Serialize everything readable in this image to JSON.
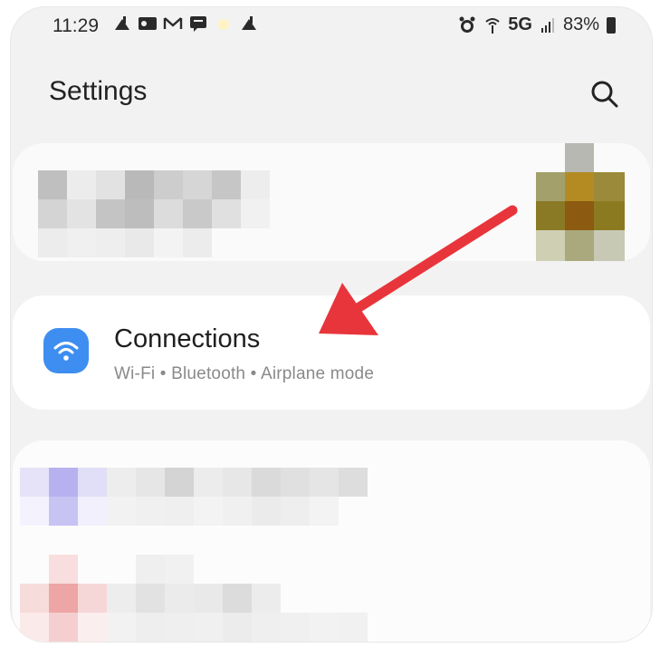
{
  "status_bar": {
    "time": "11:29",
    "network": "5G",
    "battery": "83%"
  },
  "header": {
    "title": "Settings",
    "search_icon": "search-icon"
  },
  "connections": {
    "title": "Connections",
    "subtitle": "Wi-Fi • Bluetooth • Airplane mode",
    "icon": "wifi-icon",
    "icon_color": "#3d8ef0"
  },
  "annotation": {
    "arrow_color": "#e8353b"
  }
}
